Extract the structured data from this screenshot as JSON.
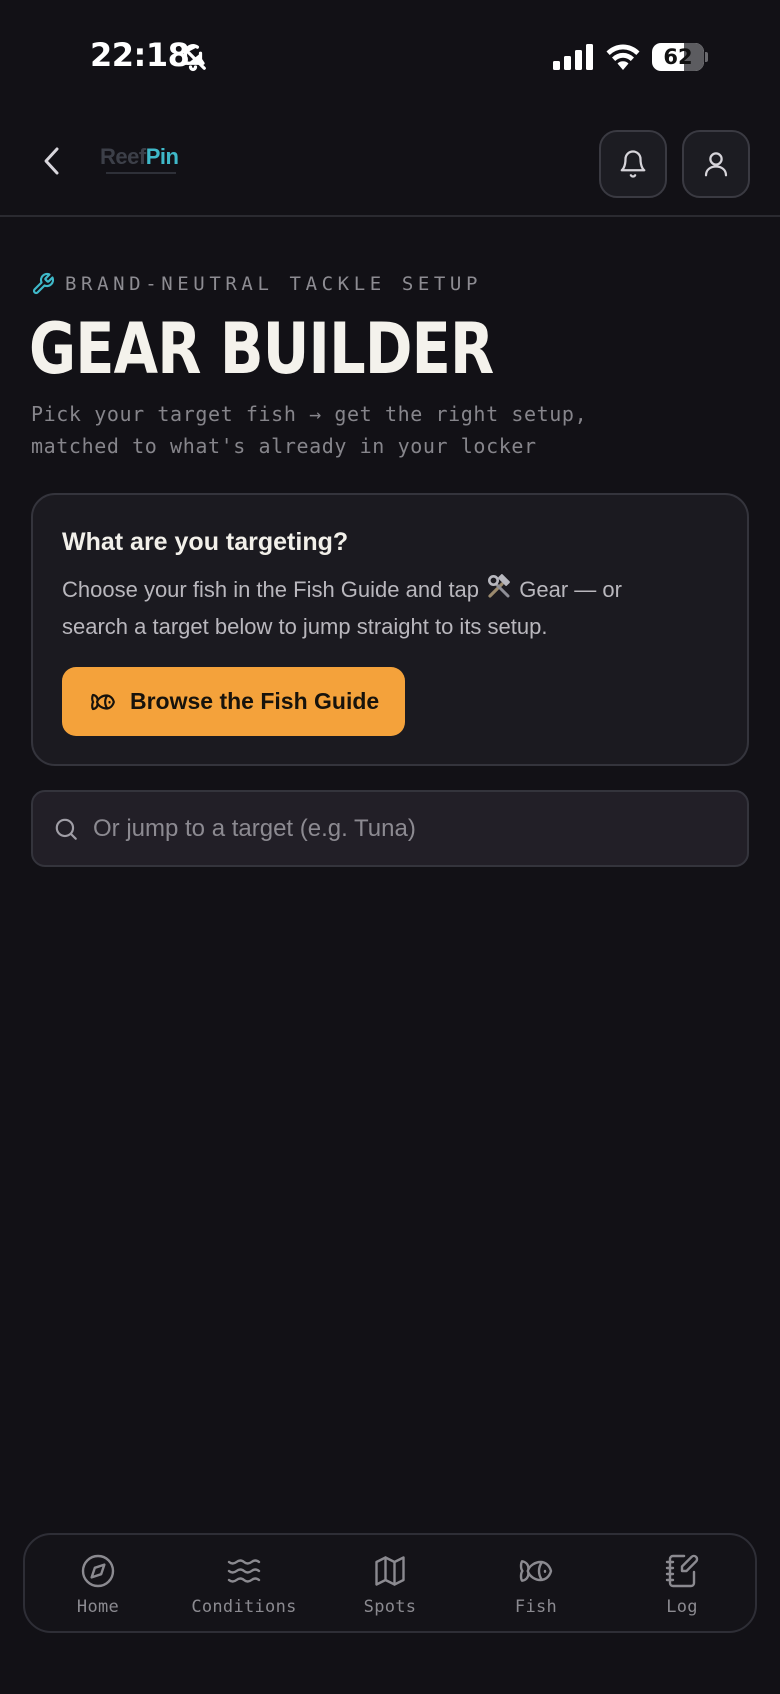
{
  "status_bar": {
    "time": "22:18",
    "battery_percent": 62,
    "battery_label": "62",
    "icons": [
      "bell-slash-icon",
      "cellular-signal-icon",
      "wifi-icon",
      "battery-icon"
    ]
  },
  "header": {
    "logo": {
      "part1": "Reef",
      "part2": "Pin"
    },
    "icons": [
      "chevron-left-icon",
      "bell-icon",
      "user-icon"
    ]
  },
  "hero": {
    "eyebrow": "BRAND-NEUTRAL TACKLE SETUP",
    "title": "GEAR BUILDER",
    "subtitle_line1": "Pick your target fish → get the right setup,",
    "subtitle_line2": "matched to what's already in your locker"
  },
  "target_card": {
    "title": "What are you targeting?",
    "body_line1_pre": "Choose your fish in the Fish Guide and tap ",
    "body_line1_post": " Gear — or",
    "body_line2": "search a target below to jump straight to its setup.",
    "cta_label": "Browse the Fish Guide"
  },
  "search": {
    "placeholder": "Or jump to a target (e.g. Tuna)",
    "value": ""
  },
  "bottom_nav": {
    "items": [
      {
        "label": "Home",
        "icon": "compass-icon"
      },
      {
        "label": "Conditions",
        "icon": "waves-icon"
      },
      {
        "label": "Spots",
        "icon": "map-icon"
      },
      {
        "label": "Fish",
        "icon": "fish-icon"
      },
      {
        "label": "Log",
        "icon": "notebook-pen-icon"
      }
    ]
  },
  "colors": {
    "background": "#121116",
    "accent": "#f4a23b",
    "teal": "#3fb9c9",
    "card": "#1b1a20"
  }
}
